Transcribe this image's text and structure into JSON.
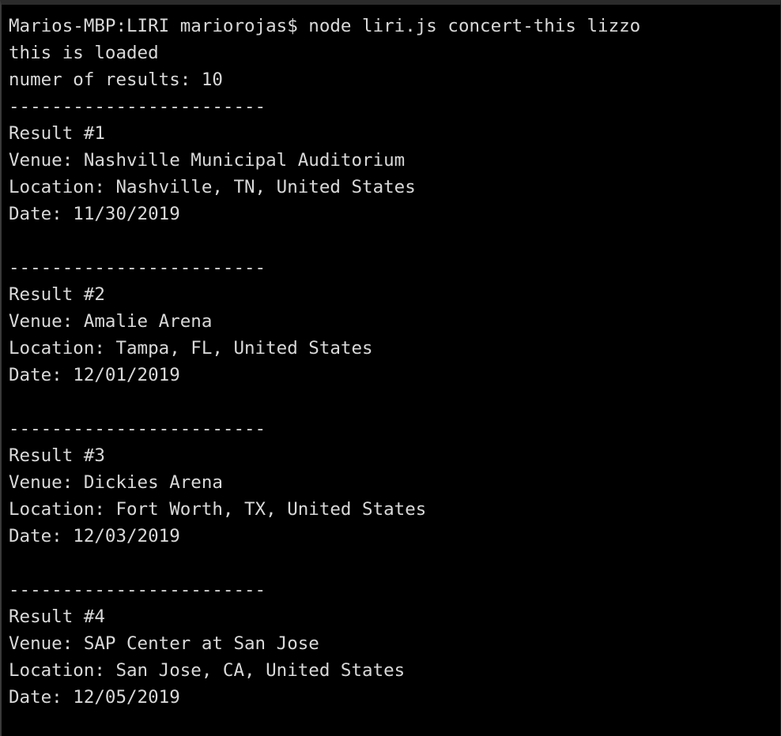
{
  "terminal": {
    "prompt": "Marios-MBP:LIRI mariorojas$",
    "command": "node liri.js concert-this lizzo",
    "loaded_message": "this is loaded",
    "results_count_label": "numer of results: 10",
    "separator": "------------------------",
    "text_color": "#d9d9d9",
    "background_color": "#000000",
    "results": [
      {
        "heading": "Result #1",
        "venue": "Venue: Nashville Municipal Auditorium",
        "location": "Location: Nashville, TN, United States",
        "date": "Date: 11/30/2019"
      },
      {
        "heading": "Result #2",
        "venue": "Venue: Amalie Arena",
        "location": "Location: Tampa, FL, United States",
        "date": "Date: 12/01/2019"
      },
      {
        "heading": "Result #3",
        "venue": "Venue: Dickies Arena",
        "location": "Location: Fort Worth, TX, United States",
        "date": "Date: 12/03/2019"
      },
      {
        "heading": "Result #4",
        "venue": "Venue: SAP Center at San Jose",
        "location": "Location: San Jose, CA, United States",
        "date": "Date: 12/05/2019"
      }
    ]
  }
}
